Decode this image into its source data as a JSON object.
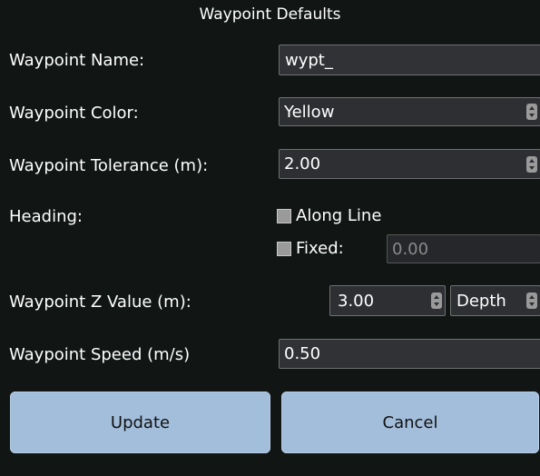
{
  "dialog": {
    "title": "Waypoint Defaults"
  },
  "name": {
    "label": "Waypoint Name:",
    "value": "wypt_"
  },
  "color": {
    "label": "Waypoint Color:",
    "value": "Yellow"
  },
  "tolerance": {
    "label": "Waypoint Tolerance (m):",
    "value": "2.00"
  },
  "heading": {
    "label": "Heading:",
    "along_line_label": "Along Line",
    "fixed_label": "Fixed:",
    "fixed_value": "0.00"
  },
  "z_value": {
    "label": "Waypoint Z Value (m):",
    "value": "3.00",
    "mode": "Depth"
  },
  "speed": {
    "label": "Waypoint Speed (m/s)",
    "value": "0.50"
  },
  "buttons": {
    "update": "Update",
    "cancel": "Cancel"
  },
  "colors": {
    "background": "#111615",
    "field": "#2d2f33",
    "button": "#a3bedb"
  },
  "icons": {
    "spinner": "spinner-arrows-icon",
    "checkbox": "checkbox-icon"
  }
}
